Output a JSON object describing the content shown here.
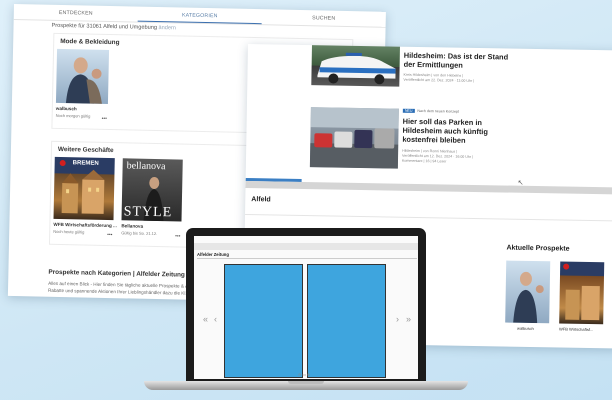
{
  "left_page": {
    "tabs": [
      "ENTDECKEN",
      "KATEGORIEN",
      "SUCHEN"
    ],
    "active_tab": 1,
    "subtitle": "Prospekte für 31061 Alfeld und Umgebung",
    "subtitle_suffix": "ändern",
    "section_mode": {
      "title": "Mode & Bekleidung",
      "item": {
        "name": "walbusch",
        "validity": "Noch morgen gültig"
      }
    },
    "section_weitere": {
      "title": "Weitere Geschäfte",
      "items": [
        {
          "name": "WFB Wirtschaftsförderung ...",
          "validity": "Noch heute gültig",
          "banner": "BREMEN"
        },
        {
          "name": "Bellanova",
          "validity": "Gültig bis So. 21.12.",
          "banner": "bellanova",
          "style_word": "STYLE"
        }
      ]
    },
    "bottom": {
      "heading": "Prospekte nach Kategorien | Alfelder Zeitung",
      "text_line1": "Alles auf einen Blick - Hier finden Sie tägliche aktuelle Prospekte & An...",
      "text_line2": "Rabatte und spannende Aktionen Ihrer Lieblingshändler dazu die Kl..."
    }
  },
  "right_page": {
    "news": [
      {
        "headline_line1": "Hildesheim: Das ist der Stand",
        "headline_line2": "der Ermittlungen",
        "meta_line1": "Kreis Hildesheim | von den Hiebelns |",
        "meta_line2": "Veröffentlicht am 22. Dez. 2024 · 11:00 Uhr |"
      },
      {
        "tag": "NEU",
        "tag_text": "Nach dem neuen Konzept",
        "headline_line1": "Hier soll das Parken in",
        "headline_line2": "Hildesheim auch künftig",
        "headline_line3": "kostenfrei bleiben",
        "meta_line1": "Hildesheim | von Ronni Nienhaus |",
        "meta_line2": "Veröffentlicht am 12. Dez. 2024 · 16:00 Uhr |",
        "meta_line3": "Kommentare | 16 | 94 Leser"
      }
    ],
    "section_alfeld": "Alfeld",
    "aktuelle": {
      "title": "Aktuelle Prospekte",
      "items": [
        {
          "name": "walbusch"
        },
        {
          "name": "WFB Wirtschaftsf..."
        }
      ]
    }
  },
  "laptop": {
    "screen_logo": "Alfelder Zeitung"
  },
  "colors": {
    "background": "#d9ecf7",
    "accent_blue": "#3b7fc4",
    "page_blue": "#3ea5de"
  }
}
